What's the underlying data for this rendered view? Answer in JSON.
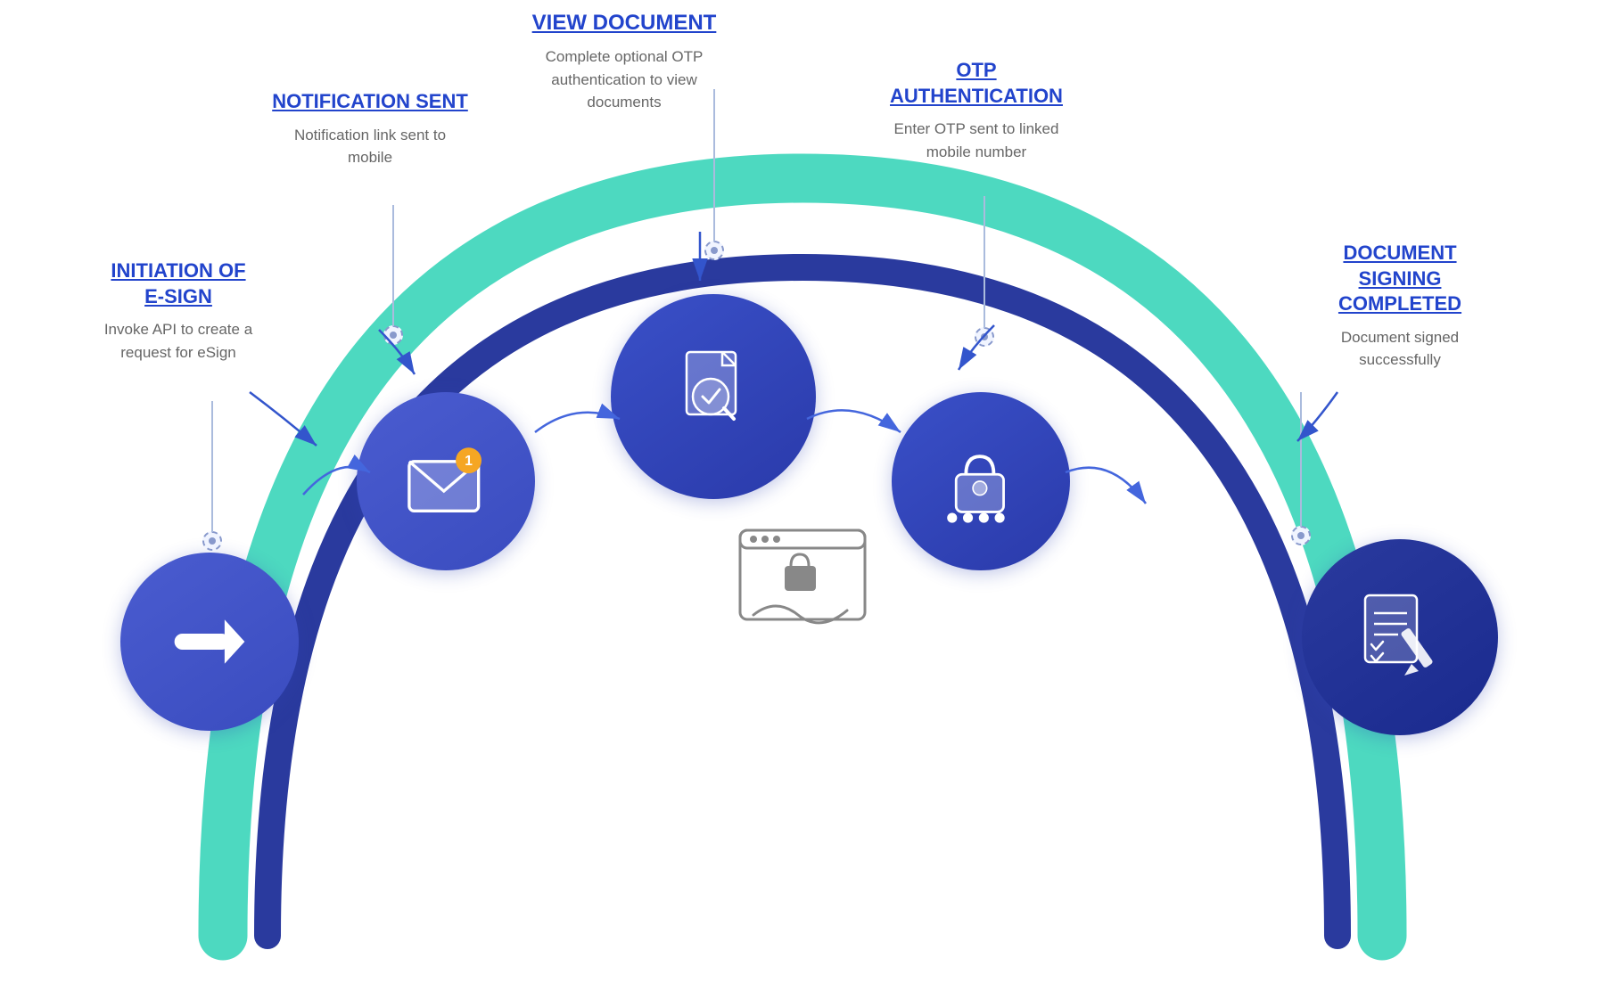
{
  "steps": [
    {
      "id": 1,
      "title": "INITIATION OF\nE-SIGN",
      "description": "Invoke API to create a\nrequest for eSign",
      "icon": "arrow"
    },
    {
      "id": 2,
      "title": "NOTIFICATION SENT",
      "description": "Notification link sent to\nmobile",
      "icon": "envelope"
    },
    {
      "id": 3,
      "title": "VIEW DOCUMENT",
      "description": "Complete optional OTP\nauthentication to view\ndocuments",
      "icon": "document-search"
    },
    {
      "id": 4,
      "title": "OTP\nAUTHENTICATION",
      "description": "Enter OTP sent to linked\nmobile number",
      "icon": "lock-otp"
    },
    {
      "id": 5,
      "title": "DOCUMENT\nSIGNING\nCOMPLETED",
      "description": "Document signed\nsuccessfully",
      "icon": "document-sign"
    }
  ],
  "labels": {
    "step1_title": "INITIATION OF\nE-SIGN",
    "step1_desc": "Invoke API to create a\nrequest for eSign",
    "step2_title": "NOTIFICATION SENT",
    "step2_desc": "Notification link sent to\nmobile",
    "step3_title": "VIEW DOCUMENT",
    "step3_desc": "Complete optional OTP\nauthentication to view\ndocuments",
    "step4_title": "OTP\nAUTHENTICATION",
    "step4_desc": "Enter OTP sent to linked\nmobile number",
    "step5_title": "DOCUMENT\nSIGNING\nCOMPLETED",
    "step5_desc": "Document signed\nsuccessfully"
  },
  "colors": {
    "accent_blue": "#2244cc",
    "circle_gradient_start": "#4a5cd0",
    "circle_gradient_end": "#2a3a9e",
    "arch_teal": "#4dd9c0",
    "arch_dark_blue": "#2a3a9e"
  }
}
